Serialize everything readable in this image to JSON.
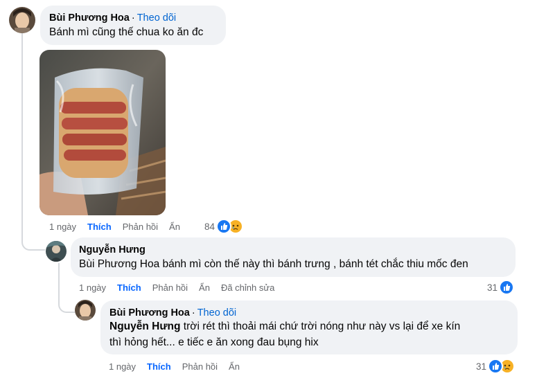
{
  "comments": [
    {
      "author": "Bùi Phương Hoa",
      "follow": "Theo dõi",
      "text": "Bánh mì cũng thế chua ko ăn đc",
      "actions": {
        "time": "1 ngày",
        "like": "Thích",
        "reply": "Phản hồi",
        "hide": "Ẩn"
      },
      "reactions": {
        "count": "84",
        "icons": [
          "like-icon",
          "sad-icon"
        ]
      }
    },
    {
      "author": "Nguyễn Hưng",
      "text": "Bùi Phương Hoa bánh mì còn thế này thì bánh trưng , bánh tét chắc thiu mốc đen",
      "actions": {
        "time": "1 ngày",
        "like": "Thích",
        "reply": "Phản hồi",
        "hide": "Ẩn",
        "edited": "Đã chỉnh sửa"
      },
      "reactions": {
        "count": "31",
        "icons": [
          "like-icon"
        ]
      }
    },
    {
      "author": "Bùi Phương Hoa",
      "follow": "Theo dõi",
      "mention": "Nguyễn Hưng",
      "text_line1": " trời rét thì thoải mái chứ trời nóng như này vs lại để xe kín",
      "text_line2": "thì hỏng hết... e tiếc e ăn xong đau bụng hix",
      "actions": {
        "time": "1 ngày",
        "like": "Thích",
        "reply": "Phản hồi",
        "hide": "Ẩn"
      },
      "reactions": {
        "count": "31",
        "icons": [
          "like-icon",
          "sad-icon"
        ]
      }
    }
  ],
  "colors": {
    "link": "#0064d1",
    "liked": "#0866ff",
    "bubble": "#f0f2f5",
    "meta": "#65676b"
  }
}
